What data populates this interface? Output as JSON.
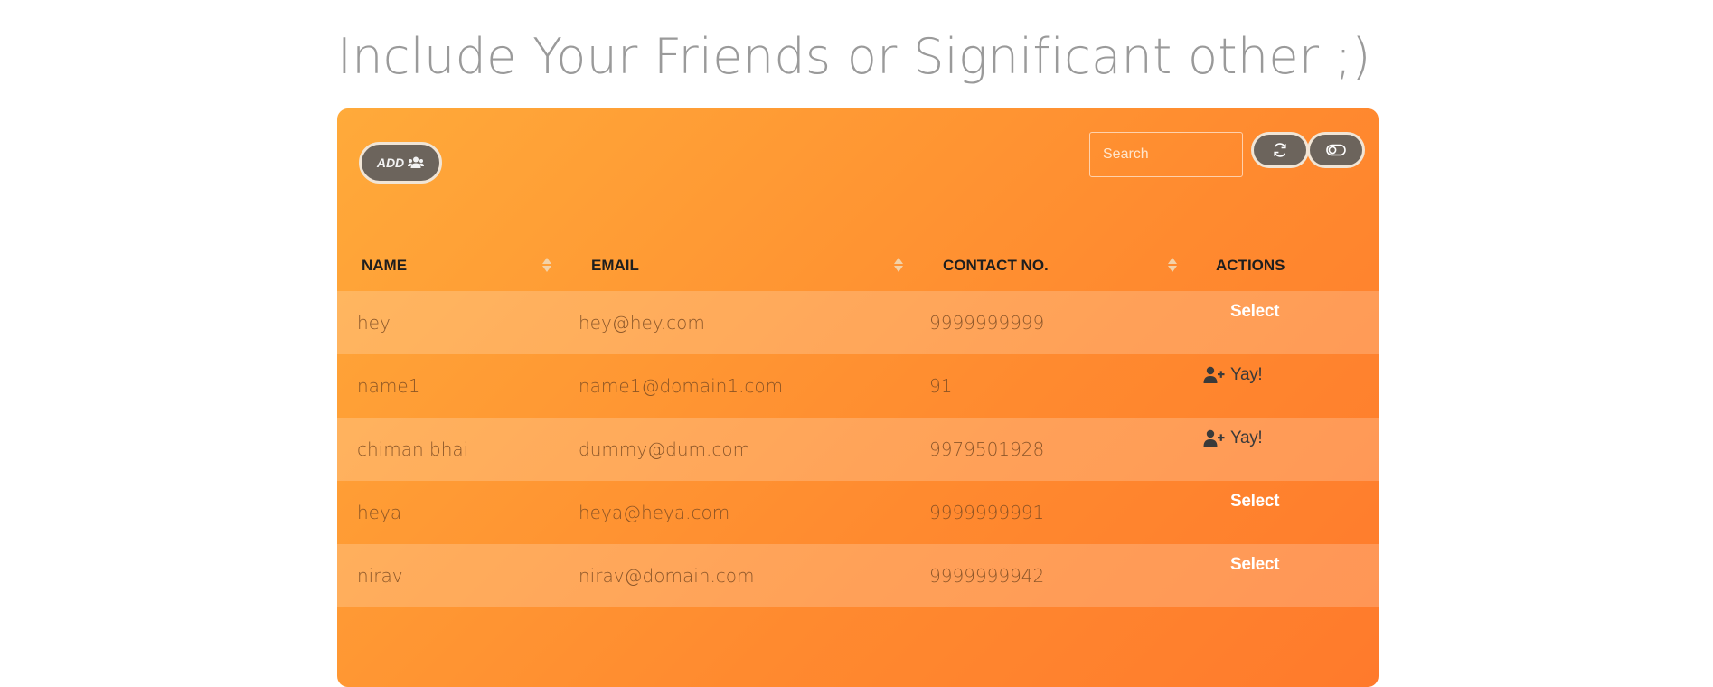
{
  "page": {
    "title": "Include Your Friends or Significant other ;)"
  },
  "toolbar": {
    "add_label": "ADD",
    "add_icon": "users-icon",
    "search_placeholder": "Search",
    "refresh_icon": "refresh-icon",
    "toggle_icon": "toggle-icon"
  },
  "table": {
    "columns": [
      "NAME",
      "EMAIL",
      "CONTACT NO.",
      "ACTIONS"
    ],
    "rows": [
      {
        "name": "hey",
        "email": "hey@hey.com",
        "contact": "9999999999",
        "action": "Select",
        "action_type": "select"
      },
      {
        "name": "name1",
        "email": "name1@domain1.com",
        "contact": "91",
        "action": "Yay!",
        "action_type": "yay"
      },
      {
        "name": "chiman bhai",
        "email": "dummy@dum.com",
        "contact": "9979501928",
        "action": "Yay!",
        "action_type": "yay"
      },
      {
        "name": "heya",
        "email": "heya@heya.com",
        "contact": "9999999991",
        "action": "Select",
        "action_type": "select"
      },
      {
        "name": "nirav",
        "email": "nirav@domain.com",
        "contact": "9999999942",
        "action": "Select",
        "action_type": "select"
      }
    ]
  },
  "colors": {
    "panel_start": "#ffaa3a",
    "panel_end": "#ff7a2c",
    "button_bg": "#6c645c",
    "button_border": "#f1e5d6"
  }
}
